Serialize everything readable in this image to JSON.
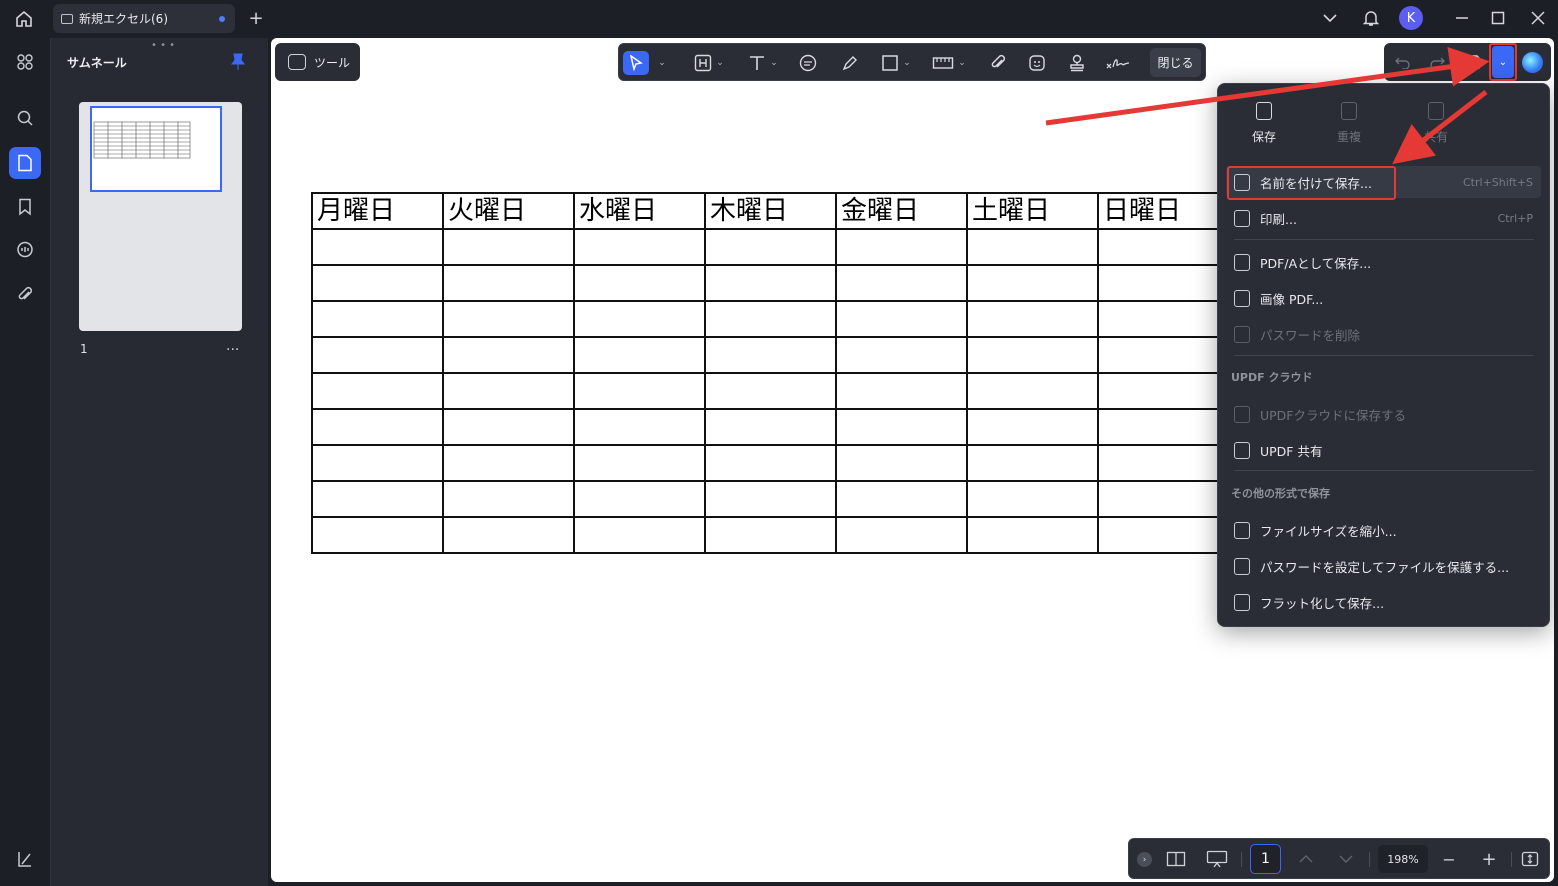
{
  "titlebar": {
    "tab_title": "新規エクセル(6)",
    "new_tab": "+",
    "avatar_initial": "K",
    "icons": [
      "home-icon",
      "document-icon",
      "chevron-down-icon",
      "bell-icon",
      "minimize-icon",
      "maximize-icon",
      "close-icon"
    ]
  },
  "rail": {
    "items": [
      "apps-grid-icon",
      "search-icon",
      "pages-icon",
      "bookmark-icon",
      "comment-icon",
      "attachment-icon",
      "sidebar-toggle-icon"
    ],
    "active": "pages-icon"
  },
  "thumbnail_panel": {
    "title": "サムネール",
    "page_number": "1",
    "more": "..."
  },
  "toolbar": {
    "tool_label": "ツール",
    "close_label": "閉じる",
    "tools": [
      "select-icon",
      "text-box-icon",
      "text-icon",
      "comment-icon",
      "highlight-icon",
      "shape-icon",
      "measure-icon",
      "attachment-icon",
      "sticker-icon",
      "stamp-icon",
      "signature-icon"
    ]
  },
  "right_toolbar": {
    "icons": [
      "undo-icon",
      "redo-icon",
      "save-icon",
      "save-dropdown-icon",
      "ai-assistant-icon"
    ]
  },
  "sheet": {
    "headers": [
      "月曜日",
      "火曜日",
      "水曜日",
      "木曜日",
      "金曜日",
      "土曜日",
      "日曜日"
    ],
    "empty_rows": 9
  },
  "menu": {
    "top_actions": [
      {
        "label": "保存",
        "icon": "save-icon",
        "enabled": true
      },
      {
        "label": "重複",
        "icon": "duplicate-icon",
        "enabled": false
      },
      {
        "label": "共有",
        "icon": "share-icon",
        "enabled": false
      }
    ],
    "save_as": {
      "label": "名前を付けて保存...",
      "shortcut": "Ctrl+Shift+S"
    },
    "print": {
      "label": "印刷...",
      "shortcut": "Ctrl+P"
    },
    "pdfa": {
      "label": "PDF/Aとして保存..."
    },
    "image_pdf": {
      "label": "画像 PDF..."
    },
    "remove_password": {
      "label": "パスワードを削除"
    },
    "cloud_section": "UPDF クラウド",
    "save_cloud": {
      "label": "UPDFクラウドに保存する"
    },
    "share": {
      "label": "UPDF 共有"
    },
    "other_section": "その他の形式で保存",
    "reduce_size": {
      "label": "ファイルサイズを縮小..."
    },
    "protect": {
      "label": "パスワードを設定してファイルを保護する..."
    },
    "flatten": {
      "label": "フラット化して保存..."
    }
  },
  "bottombar": {
    "current_page": "1",
    "zoom": "198%",
    "minus": "−",
    "plus": "+"
  },
  "colors": {
    "accent": "#3b68f4",
    "annotation": "#e53935",
    "panel": "#2a2d35"
  }
}
